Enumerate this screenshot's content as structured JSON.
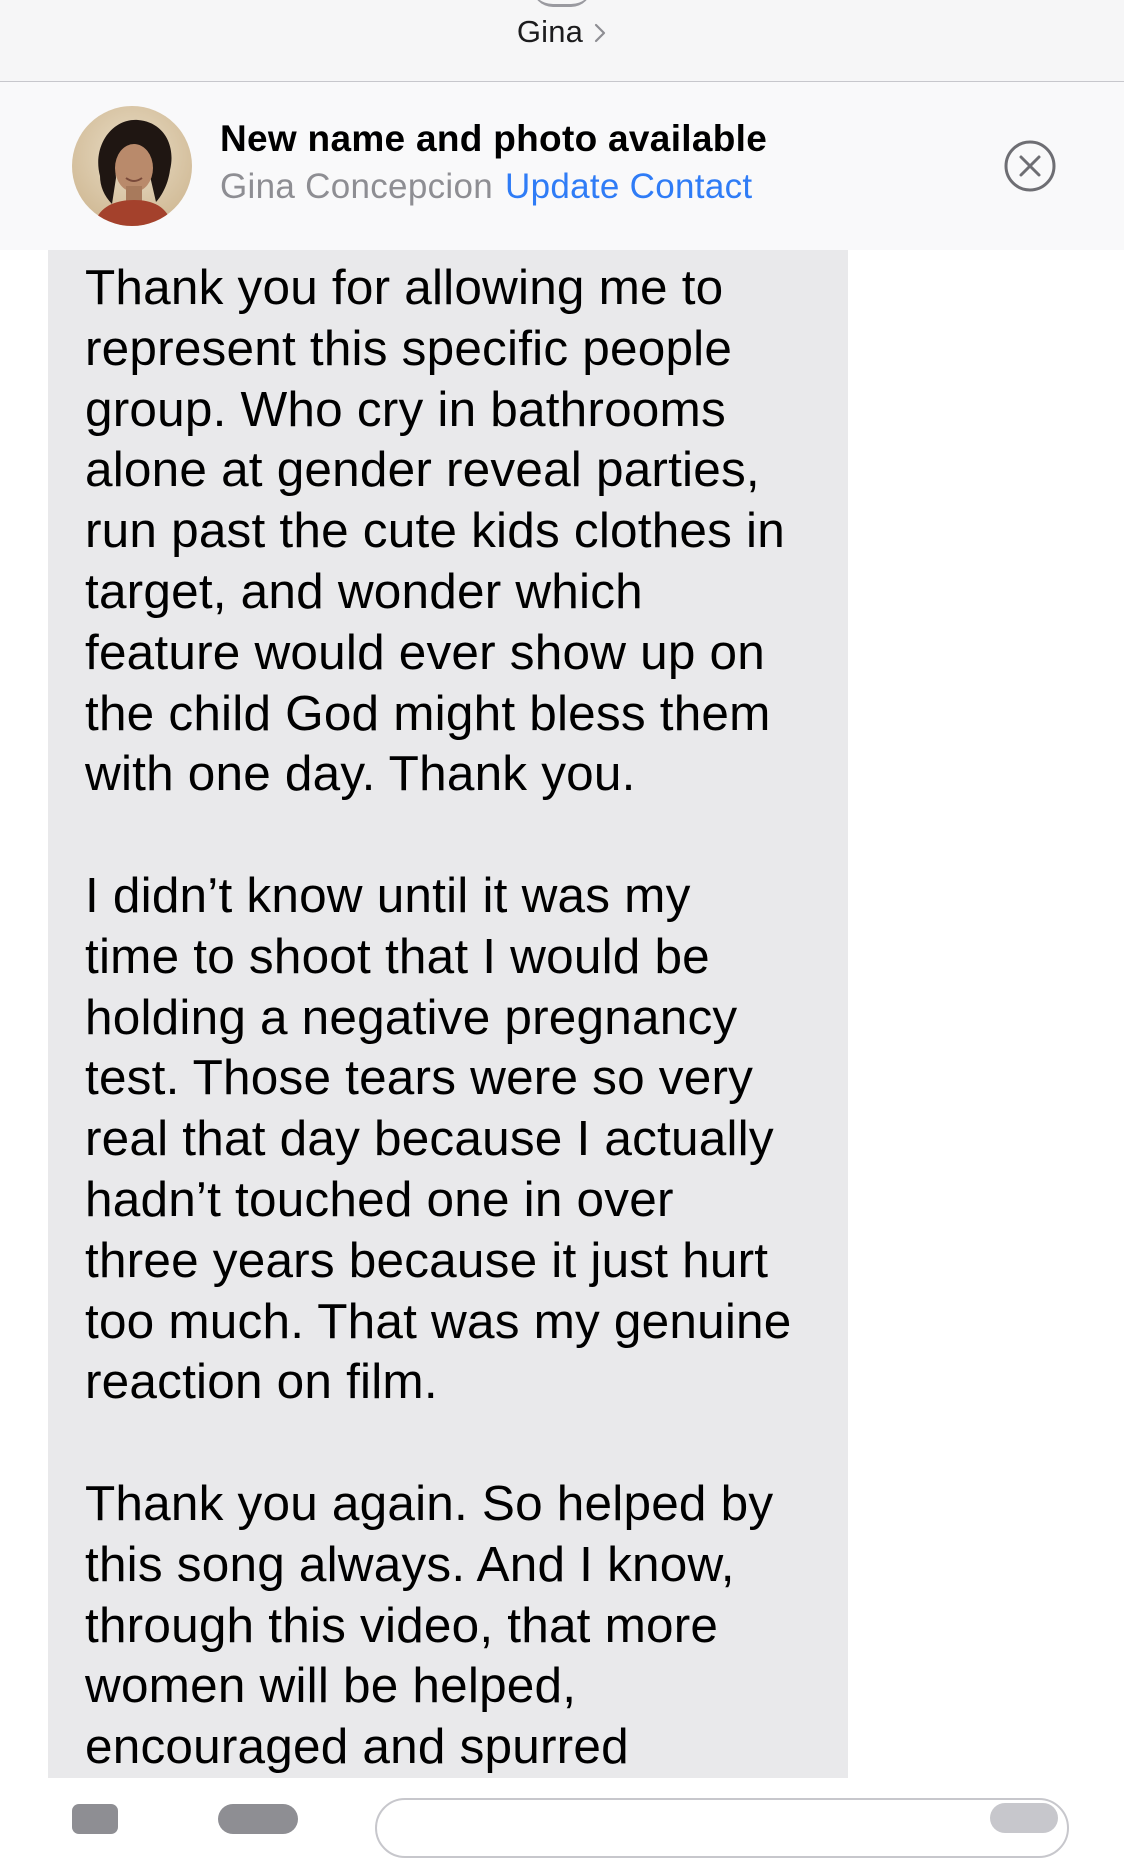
{
  "header": {
    "contact_name": "Gina"
  },
  "banner": {
    "title": "New name and photo available",
    "contact_full_name": "Gina Concepcion",
    "update_link": "Update Contact"
  },
  "message": {
    "text": "Thank you for allowing me to\nrepresent this specific people\ngroup. Who cry in bathrooms\nalone at gender reveal parties,\nrun past the cute kids clothes in\ntarget, and wonder which\nfeature would ever show up on\nthe child God might bless them\nwith one day. Thank you.\n\nI didn’t know until it was my\ntime to shoot that I would be\nholding a negative pregnancy\ntest. Those tears were so very\nreal that day because I actually\nhadn’t touched one in over\nthree years because it just hurt\ntoo much. That was my genuine\nreaction on film.\n\nThank you again. So helped by\nthis song always. And I know,\nthrough this video, that more\nwomen will be helped,\nencouraged and spurred"
  },
  "colors": {
    "link_blue": "#2f7cf6",
    "bubble_gray": "#e9e9eb",
    "secondary_text": "#8e8e93"
  },
  "icons": {
    "chevron": "chevron-right-icon",
    "close": "close-circle-icon",
    "camera": "camera-icon",
    "apps": "app-store-icon",
    "mic": "microphone-icon"
  }
}
